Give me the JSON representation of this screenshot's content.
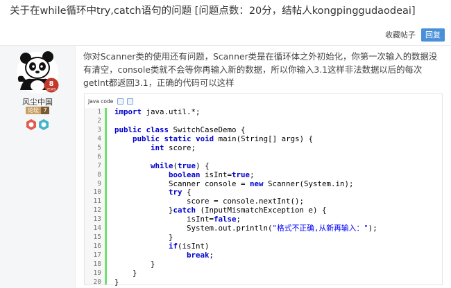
{
  "topic": {
    "title": "关于在while循环中try,catch语句的问题 [问题点数：20分，结帖人kongpinggudaodeai]"
  },
  "actions": {
    "collect_label": "收藏帖子",
    "reply_label": "回复"
  },
  "author": {
    "name": "风尘中国",
    "avatar_years": "8",
    "avatar_years_unit": "YEARS",
    "level_label": "论坛",
    "level_num": "7",
    "medal_colors": [
      "#e25b4c",
      "#43b4c9"
    ]
  },
  "post": {
    "text": "你对Scanner类的使用还有问题，Scanner类是在循环体之外初始化，你第一次输入的数据没有清空，console类就不会等你再输入新的数据，所以你输入3.1这样非法数据以后的每次getInt都返回3.1，正确的代码可以这样"
  },
  "code": {
    "language_label": "Java code",
    "line_numbers": [
      "1",
      "2",
      "3",
      "4",
      "5",
      "6",
      "7",
      "8",
      "9",
      "10",
      "11",
      "12",
      "13",
      "14",
      "15",
      "16",
      "17",
      "18",
      "19",
      "20"
    ],
    "lines": [
      [
        {
          "k": "kw",
          "t": "import"
        },
        {
          "k": "",
          "t": " java.util.*;"
        }
      ],
      [],
      [
        {
          "k": "kw",
          "t": "public"
        },
        {
          "k": "",
          "t": " "
        },
        {
          "k": "kw",
          "t": "class"
        },
        {
          "k": "",
          "t": " SwitchCaseDemo {"
        }
      ],
      [
        {
          "k": "",
          "t": "    "
        },
        {
          "k": "kw",
          "t": "public"
        },
        {
          "k": "",
          "t": " "
        },
        {
          "k": "kw",
          "t": "static"
        },
        {
          "k": "",
          "t": " "
        },
        {
          "k": "kw",
          "t": "void"
        },
        {
          "k": "",
          "t": " main(String[] args) {"
        }
      ],
      [
        {
          "k": "",
          "t": "        "
        },
        {
          "k": "kw",
          "t": "int"
        },
        {
          "k": "",
          "t": " score;"
        }
      ],
      [],
      [
        {
          "k": "",
          "t": "        "
        },
        {
          "k": "kw",
          "t": "while"
        },
        {
          "k": "",
          "t": "("
        },
        {
          "k": "kw",
          "t": "true"
        },
        {
          "k": "",
          "t": ") {"
        }
      ],
      [
        {
          "k": "",
          "t": "            "
        },
        {
          "k": "kw",
          "t": "boolean"
        },
        {
          "k": "",
          "t": " isInt="
        },
        {
          "k": "kw",
          "t": "true"
        },
        {
          "k": "",
          "t": ";"
        }
      ],
      [
        {
          "k": "",
          "t": "            Scanner console = "
        },
        {
          "k": "kw",
          "t": "new"
        },
        {
          "k": "",
          "t": " Scanner(System.in);"
        }
      ],
      [
        {
          "k": "",
          "t": "            "
        },
        {
          "k": "kw",
          "t": "try"
        },
        {
          "k": "",
          "t": " {"
        }
      ],
      [
        {
          "k": "",
          "t": "                score = console.nextInt();"
        }
      ],
      [
        {
          "k": "",
          "t": "            }"
        },
        {
          "k": "kw",
          "t": "catch"
        },
        {
          "k": "",
          "t": " (InputMismatchException e) {"
        }
      ],
      [
        {
          "k": "",
          "t": "                isInt="
        },
        {
          "k": "kw",
          "t": "false"
        },
        {
          "k": "",
          "t": ";"
        }
      ],
      [
        {
          "k": "",
          "t": "                System.out.println("
        },
        {
          "k": "str",
          "t": "\"格式不正确,从新再输入：\""
        },
        {
          "k": "",
          "t": ");"
        }
      ],
      [
        {
          "k": "",
          "t": "            }"
        }
      ],
      [
        {
          "k": "",
          "t": "            "
        },
        {
          "k": "kw",
          "t": "if"
        },
        {
          "k": "",
          "t": "(isInt)"
        }
      ],
      [
        {
          "k": "",
          "t": "                "
        },
        {
          "k": "kw",
          "t": "break"
        },
        {
          "k": "",
          "t": ";"
        }
      ],
      [
        {
          "k": "",
          "t": "        }"
        }
      ],
      [
        {
          "k": "",
          "t": "    }"
        }
      ],
      [
        {
          "k": "",
          "t": "}"
        }
      ]
    ]
  }
}
